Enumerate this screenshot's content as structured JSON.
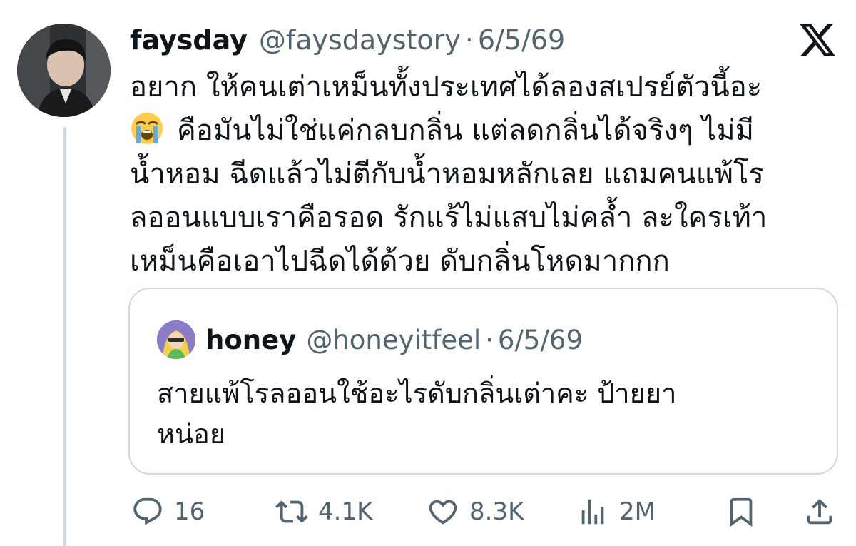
{
  "tweet": {
    "author_name": "faysday",
    "author_handle": "@faysdaystory",
    "separator": "·",
    "date": "6/5/69",
    "text_line1": "อยาก ให้คนเต่าเหม็นทั้งประเทศได้ลองสเปรย์ตัวนี้อะ",
    "emoji": "loudly-crying-face",
    "text_line2": "คือมันไม่ใช่แค่กลบกลิ่น แต่ลดกลิ่นได้จริงๆ ไม่มี",
    "text_line3": "น้ำหอม ฉีดแล้วไม่ตีกับน้ำหอมหลักเลย แถมคนแพ้โร",
    "text_line4": "ลออนแบบเราคือรอด รักแร้ไม่แสบไม่คล้ำ ละใครเท้า",
    "text_line5": "เหม็นคือเอาไปฉีดได้ด้วย ดับกลิ่นโหดมากกก"
  },
  "quote": {
    "author_name": "honey",
    "author_handle": "@honeyitfeel",
    "separator": "·",
    "date": "6/5/69",
    "text_line1": "สายแพ้โรลออนใช้อะไรดับกลิ่นเต่าคะ ป้ายยา",
    "text_line2": "หน่อย"
  },
  "actions": {
    "replies": "16",
    "reposts": "4.1K",
    "likes": "8.3K",
    "views": "2M"
  },
  "colors": {
    "text_primary": "#0f1419",
    "text_secondary": "#536471",
    "border": "#cfd9de"
  },
  "icons": [
    "x-logo-icon",
    "reply-icon",
    "retweet-icon",
    "like-icon",
    "views-icon",
    "bookmark-icon",
    "share-icon"
  ]
}
